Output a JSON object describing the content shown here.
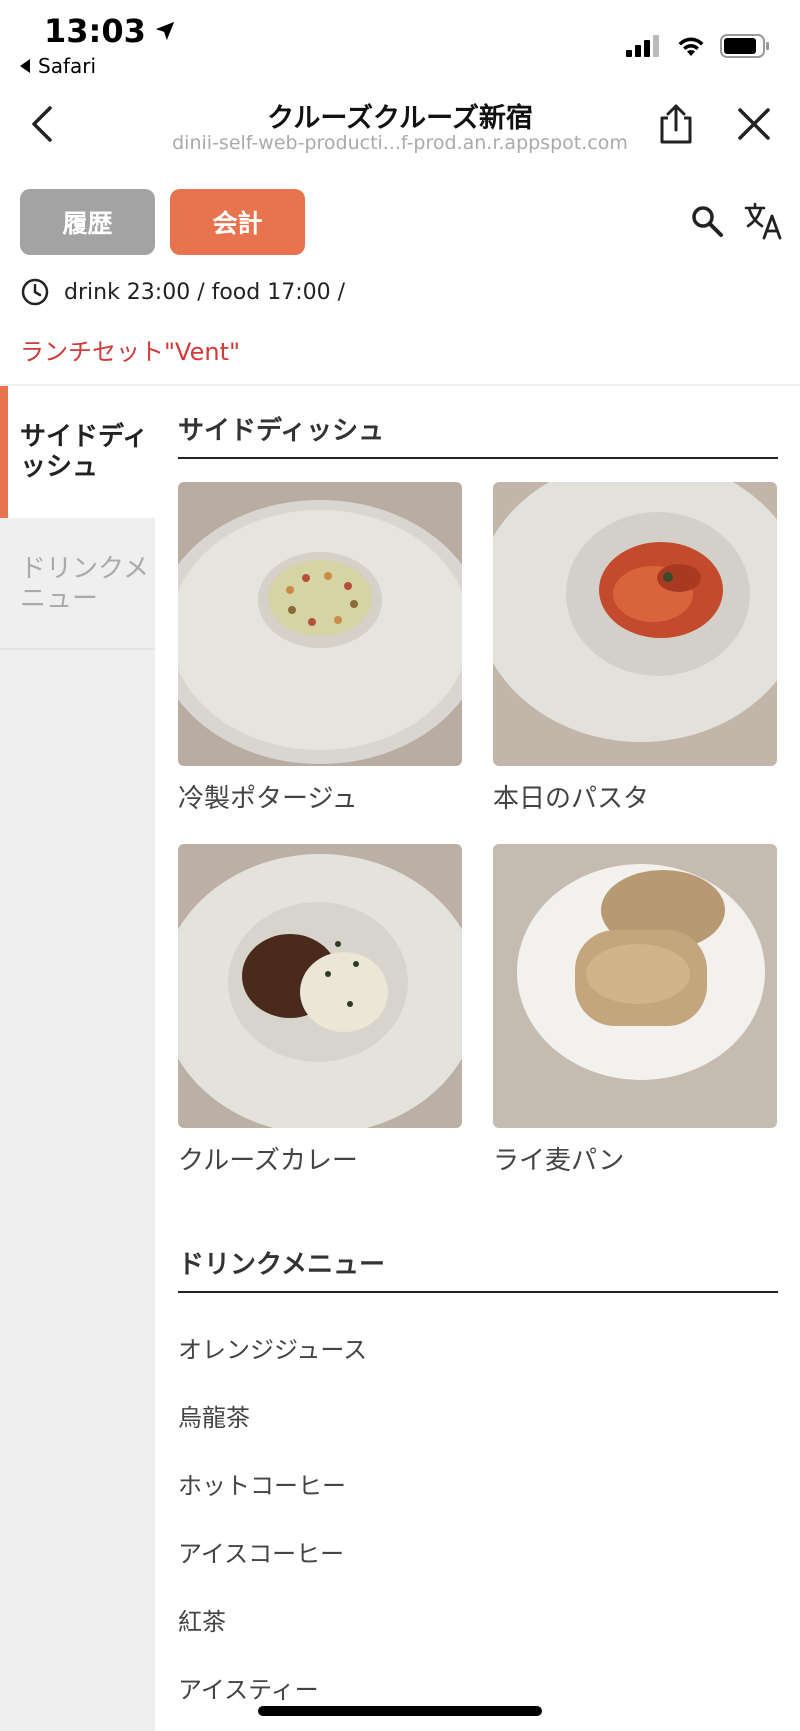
{
  "status_bar": {
    "time": "13:03",
    "back_app_label": "Safari",
    "signal_icon": "cellular-signal-icon",
    "wifi_icon": "wifi-icon",
    "battery_icon": "battery-icon"
  },
  "browser": {
    "title": "クルーズクルーズ新宿",
    "url": "dinii-self-web-producti...f-prod.an.r.appspot.com",
    "back_icon": "chevron-left-icon",
    "share_icon": "share-icon",
    "close_icon": "close-icon"
  },
  "actions": {
    "history_label": "履歴",
    "checkout_label": "会計",
    "search_icon": "search-icon",
    "translate_icon": "translate-icon"
  },
  "hours_text": "drink 23:00 / food 17:00 /",
  "lunch_set": "ランチセット\"Vent\"",
  "sidebar": {
    "items": [
      {
        "label": "サイドディッシュ"
      },
      {
        "label": "ドリンクメニュー"
      }
    ]
  },
  "sections": {
    "side_dish": {
      "title": "サイドディッシュ",
      "items": [
        {
          "name": "冷製ポタージュ"
        },
        {
          "name": "本日のパスタ"
        },
        {
          "name": "クルーズカレー"
        },
        {
          "name": "ライ麦パン"
        }
      ]
    },
    "drinks": {
      "title": "ドリンクメニュー",
      "items": [
        "オレンジジュース",
        "烏龍茶",
        "ホットコーヒー",
        "アイスコーヒー",
        "紅茶",
        "アイスティー"
      ]
    }
  },
  "colors": {
    "accent": "#e8744f",
    "history_button": "#a3a3a3",
    "lunch_text": "#d23a3a",
    "sidebar_bg": "#efefef"
  }
}
